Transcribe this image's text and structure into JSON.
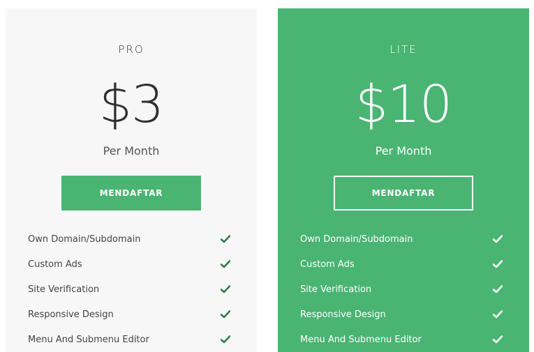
{
  "colors": {
    "accent": "#4ab473",
    "pro_card_bg": "#f7f7f7",
    "pro_check": "#2e7d45",
    "lite_check": "#ffffff"
  },
  "plans": [
    {
      "name": "PRO",
      "price": "$3",
      "period": "Per Month",
      "button_label": "MENDAFTAR",
      "features": [
        {
          "label": "Own Domain/Subdomain",
          "icon": "check-icon",
          "included": true
        },
        {
          "label": "Custom Ads",
          "icon": "check-icon",
          "included": true
        },
        {
          "label": "Site Verification",
          "icon": "check-icon",
          "included": true
        },
        {
          "label": "Responsive Design",
          "icon": "check-icon",
          "included": true
        },
        {
          "label": "Menu And Submenu Editor",
          "icon": "check-icon",
          "included": true
        }
      ]
    },
    {
      "name": "LITE",
      "price": "$10",
      "period": "Per Month",
      "button_label": "MENDAFTAR",
      "features": [
        {
          "label": "Own Domain/Subdomain",
          "icon": "check-icon",
          "included": true
        },
        {
          "label": "Custom Ads",
          "icon": "check-icon",
          "included": true
        },
        {
          "label": "Site Verification",
          "icon": "check-icon",
          "included": true
        },
        {
          "label": "Responsive Design",
          "icon": "check-icon",
          "included": true
        },
        {
          "label": "Menu And Submenu Editor",
          "icon": "check-icon",
          "included": true
        }
      ]
    }
  ]
}
